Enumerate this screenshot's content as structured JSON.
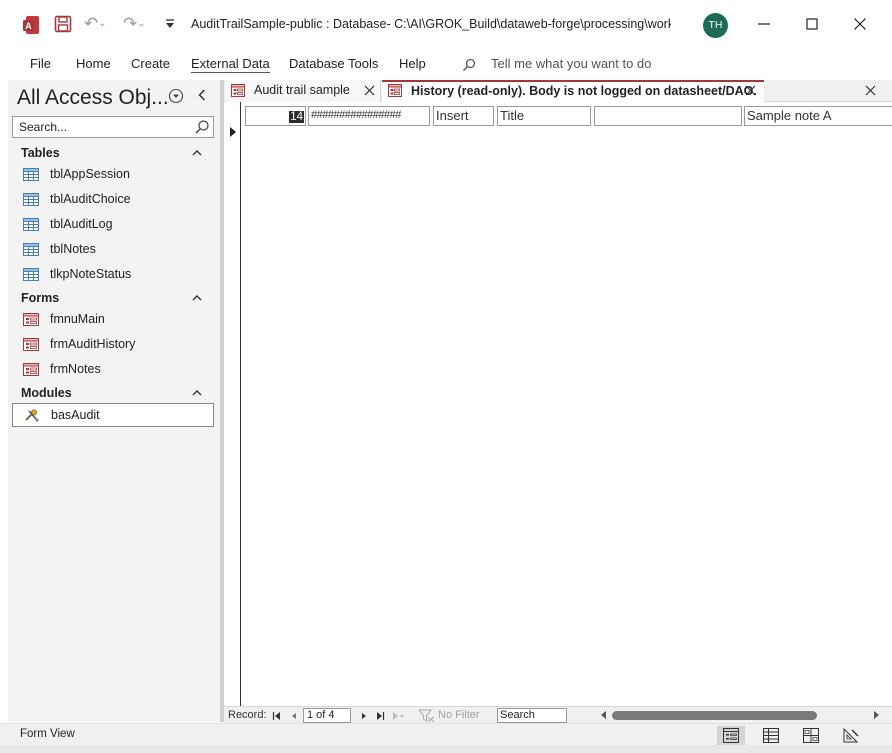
{
  "window": {
    "title": "AuditTrailSample-public : Database- C:\\AI\\GROK_Build\\dataweb-forge\\processing\\work...",
    "user_initials": "TH"
  },
  "ribbon": {
    "tabs": [
      "File",
      "Home",
      "Create",
      "External Data",
      "Database Tools",
      "Help"
    ],
    "active_tab": "External Data",
    "tell_me": "Tell me what you want to do"
  },
  "nav": {
    "title": "All Access Obj...",
    "search_placeholder": "Search...",
    "groups": [
      {
        "label": "Tables",
        "items": [
          "tblAppSession",
          "tblAuditChoice",
          "tblAuditLog",
          "tblNotes",
          "tlkpNoteStatus"
        ]
      },
      {
        "label": "Forms",
        "items": [
          "fmnuMain",
          "frmAuditHistory",
          "frmNotes"
        ]
      },
      {
        "label": "Modules",
        "items": [
          "basAudit"
        ]
      }
    ],
    "selected_item": "basAudit"
  },
  "doc_tabs": [
    {
      "label": "Audit trail sample",
      "active": false
    },
    {
      "label": "History (read-only). Body is not logged on datasheet/DAO.",
      "active": true
    }
  ],
  "record": {
    "id": "14",
    "date": "################",
    "action": "Insert",
    "field": "Title",
    "old_value": "",
    "new_value": "Sample note A"
  },
  "navbar": {
    "record_label": "Record:",
    "current": "1 of 4",
    "filter_label": "No Filter",
    "search_placeholder": "Search"
  },
  "status": {
    "text": "Form View",
    "active_view": "form-view"
  },
  "colors": {
    "accent_access": "#a4373a",
    "avatar_bg": "#1c6b55"
  }
}
